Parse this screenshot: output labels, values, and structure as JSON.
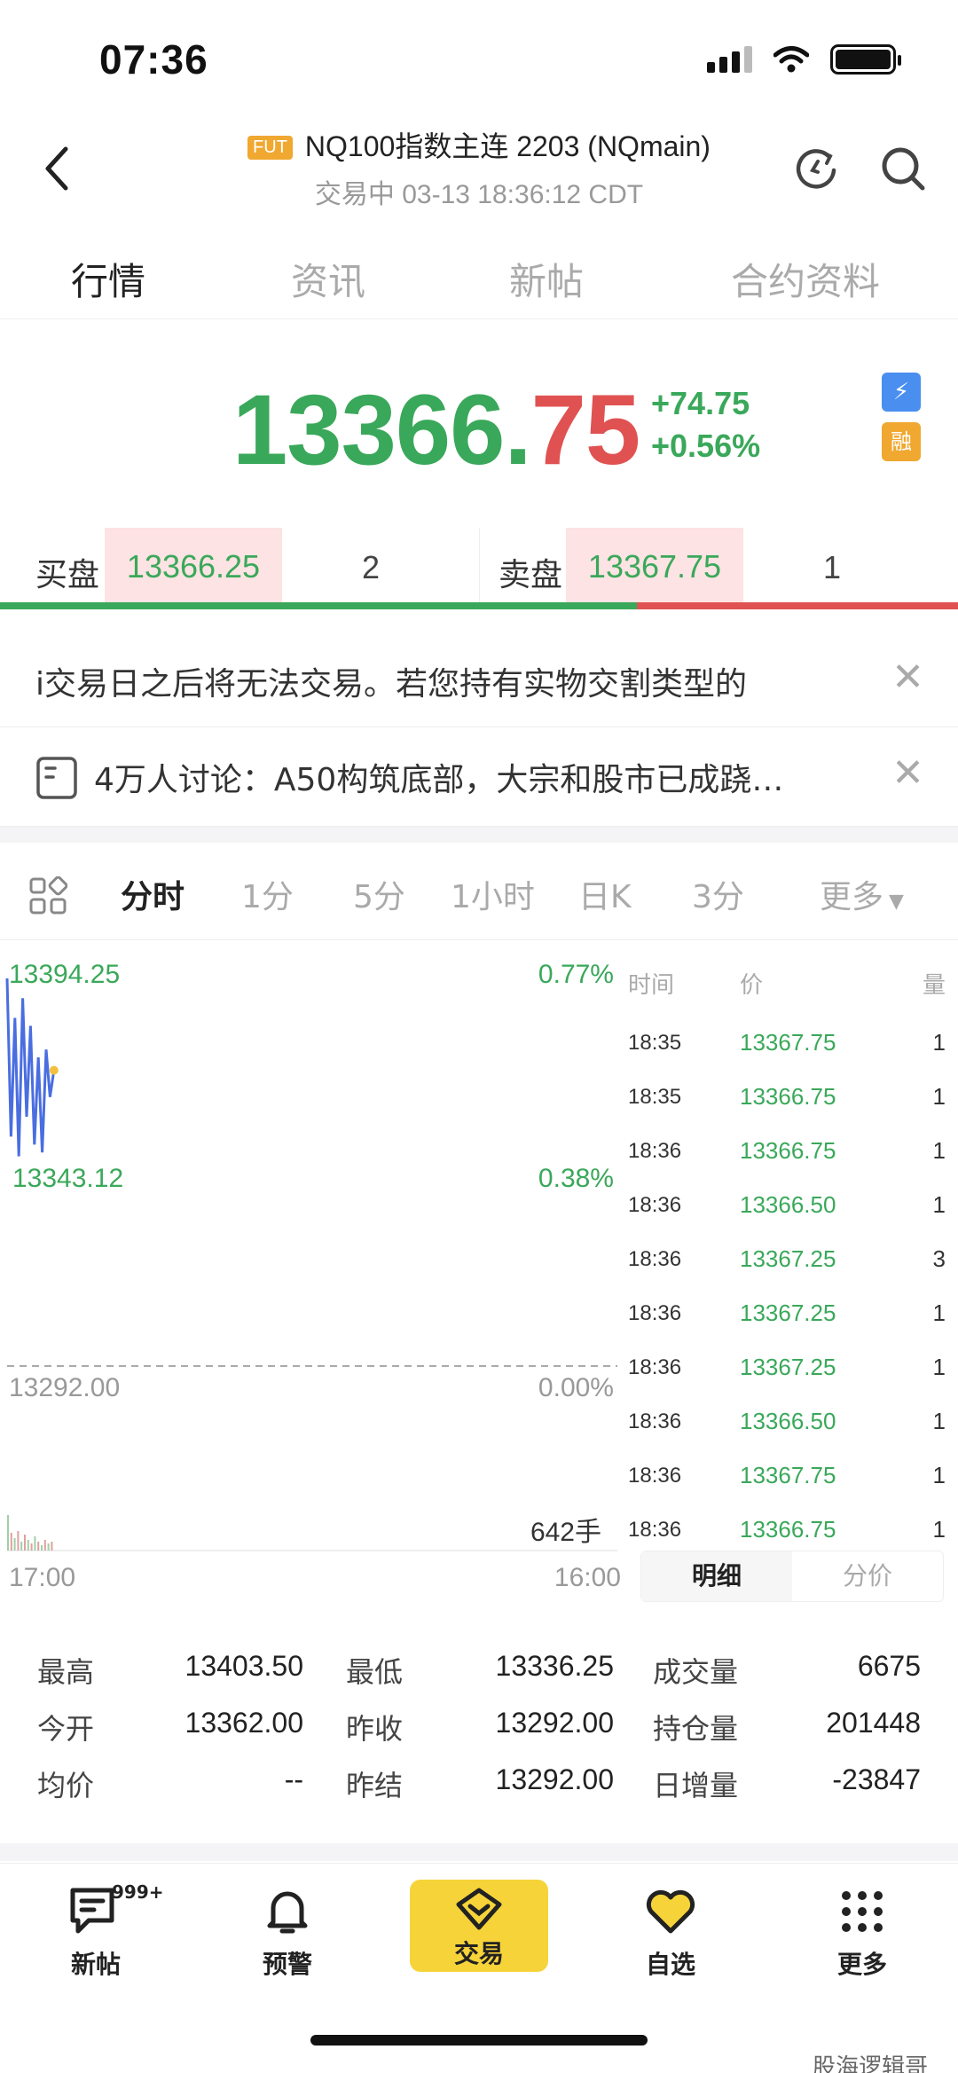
{
  "status_bar": {
    "time": "07:36"
  },
  "header": {
    "badge": "FUT",
    "title": "NQ100指数主连 2203 (NQmain)",
    "subtitle": "交易中 03-13 18:36:12 CDT"
  },
  "tabs": [
    "行情",
    "资讯",
    "新帖",
    "合约资料"
  ],
  "quote": {
    "price_main": "13366.",
    "price_decimal": "75",
    "change": "+74.75",
    "change_pct": "+0.56%",
    "colors": {
      "up": "#3aa85a",
      "down": "#e05252"
    }
  },
  "bid_ask": {
    "bid_label": "买盘",
    "bid_price": "13366.25",
    "bid_qty": "2",
    "ask_label": "卖盘",
    "ask_price": "13367.75",
    "ask_qty": "1"
  },
  "notices": [
    {
      "text": "i交易日之后将无法交易。若您持有实物交割类型的"
    },
    {
      "text": "4万人讨论：A50构筑底部，大宗和股市已成跷…"
    }
  ],
  "chart_tabs": {
    "items": [
      "分时",
      "1分",
      "5分",
      "1小时",
      "日K",
      "3分"
    ],
    "more": "更多"
  },
  "chart": {
    "top_price": "13394.25",
    "top_pct": "0.77%",
    "mid_price": "13343.12",
    "mid_pct": "0.38%",
    "base_price": "13292.00",
    "base_pct": "0.00%",
    "volume_label": "642手",
    "time_start": "17:00",
    "time_end": "16:00"
  },
  "chart_data": {
    "type": "line",
    "title": "",
    "xlabel": "",
    "ylabel": "",
    "ylim": [
      13292.0,
      13394.25
    ],
    "x_range": [
      "17:00",
      "16:00"
    ],
    "y_tick_labels": [
      "13394.25",
      "13343.12",
      "13292.00"
    ],
    "pct_tick_labels": [
      "0.77%",
      "0.38%",
      "0.00%"
    ],
    "series": [
      {
        "values": [
          13390,
          13350,
          13380,
          13345,
          13385,
          13355,
          13378,
          13348,
          13370,
          13346,
          13372,
          13360,
          13366.75
        ]
      }
    ],
    "volume_total_label": "642手"
  },
  "ticks": {
    "headers": {
      "time": "时间",
      "price": "价",
      "vol": "量"
    },
    "rows": [
      {
        "time": "18:35",
        "price": "13367.75",
        "vol": "1"
      },
      {
        "time": "18:35",
        "price": "13366.75",
        "vol": "1"
      },
      {
        "time": "18:36",
        "price": "13366.75",
        "vol": "1"
      },
      {
        "time": "18:36",
        "price": "13366.50",
        "vol": "1"
      },
      {
        "time": "18:36",
        "price": "13367.25",
        "vol": "3"
      },
      {
        "time": "18:36",
        "price": "13367.25",
        "vol": "1"
      },
      {
        "time": "18:36",
        "price": "13367.25",
        "vol": "1"
      },
      {
        "time": "18:36",
        "price": "13366.50",
        "vol": "1"
      },
      {
        "time": "18:36",
        "price": "13367.75",
        "vol": "1"
      },
      {
        "time": "18:36",
        "price": "13366.75",
        "vol": "1"
      }
    ],
    "seg_detail": "明细",
    "seg_price": "分价"
  },
  "stats": {
    "high_label": "最高",
    "high": "13403.50",
    "low_label": "最低",
    "low": "13336.25",
    "vol_label": "成交量",
    "vol": "6675",
    "open_label": "今开",
    "open": "13362.00",
    "prev_close_label": "昨收",
    "prev_close": "13292.00",
    "oi_label": "持仓量",
    "oi": "201448",
    "avg_label": "均价",
    "avg": "--",
    "prev_settle_label": "昨结",
    "prev_settle": "13292.00",
    "oi_change_label": "日增量",
    "oi_change": "-23847"
  },
  "bottom_nav": {
    "posts": "新帖",
    "posts_badge": "999+",
    "alerts": "预警",
    "trade": "交易",
    "watchlist": "自选",
    "more": "更多"
  },
  "watermark": "股海逻辑哥"
}
